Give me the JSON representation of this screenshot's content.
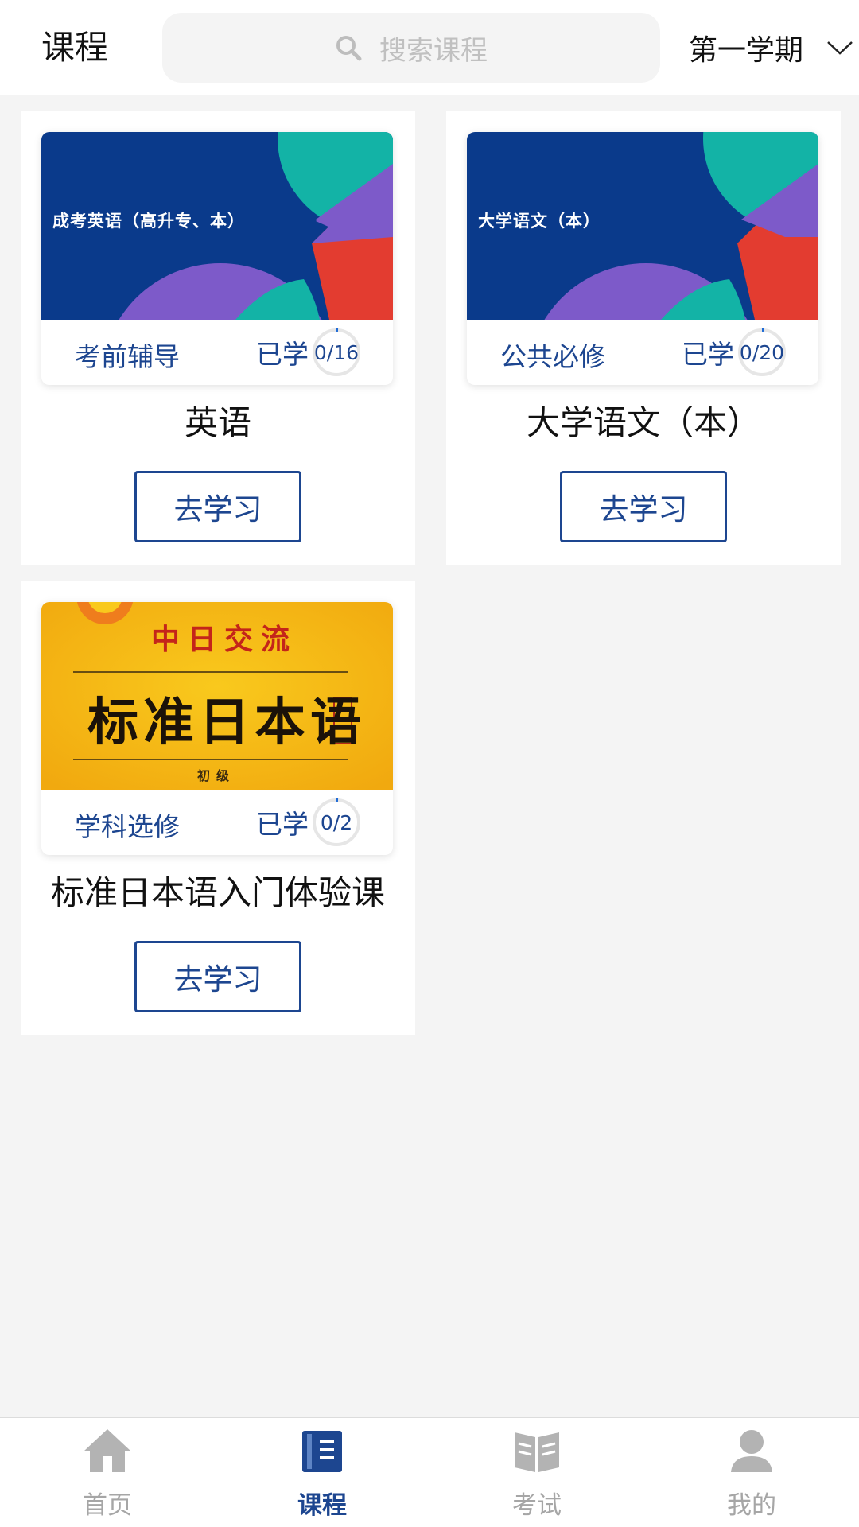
{
  "header": {
    "title": "课程",
    "search_placeholder": "搜索课程",
    "semester": "第一学期"
  },
  "courses": [
    {
      "cover_text": "成考英语（高升专、本）",
      "category": "考前辅导",
      "learned_label": "已学",
      "progress": "0/16",
      "name": "英语",
      "button": "去学习"
    },
    {
      "cover_text": "大学语文（本）",
      "category": "公共必修",
      "learned_label": "已学",
      "progress": "0/20",
      "name": "大学语文（本）",
      "button": "去学习"
    },
    {
      "cover_top": "中日交流",
      "cover_title": "标准日本语",
      "cover_bottom": "初级",
      "category": "学科选修",
      "learned_label": "已学",
      "progress": "0/2",
      "name": "标准日本语入门体验课",
      "button": "去学习"
    }
  ],
  "nav": [
    {
      "label": "首页",
      "icon": "home-icon"
    },
    {
      "label": "课程",
      "icon": "course-book-icon",
      "active": true
    },
    {
      "label": "考试",
      "icon": "exam-book-icon"
    },
    {
      "label": "我的",
      "icon": "profile-icon"
    }
  ],
  "colors": {
    "accent": "#1d4690",
    "cover_blue": "#0a3a8b",
    "teal": "#13b3a6",
    "purple": "#7d5ac9",
    "red": "#e33c30",
    "yellow": "#f4b512",
    "inactive": "#a6a6a6"
  }
}
